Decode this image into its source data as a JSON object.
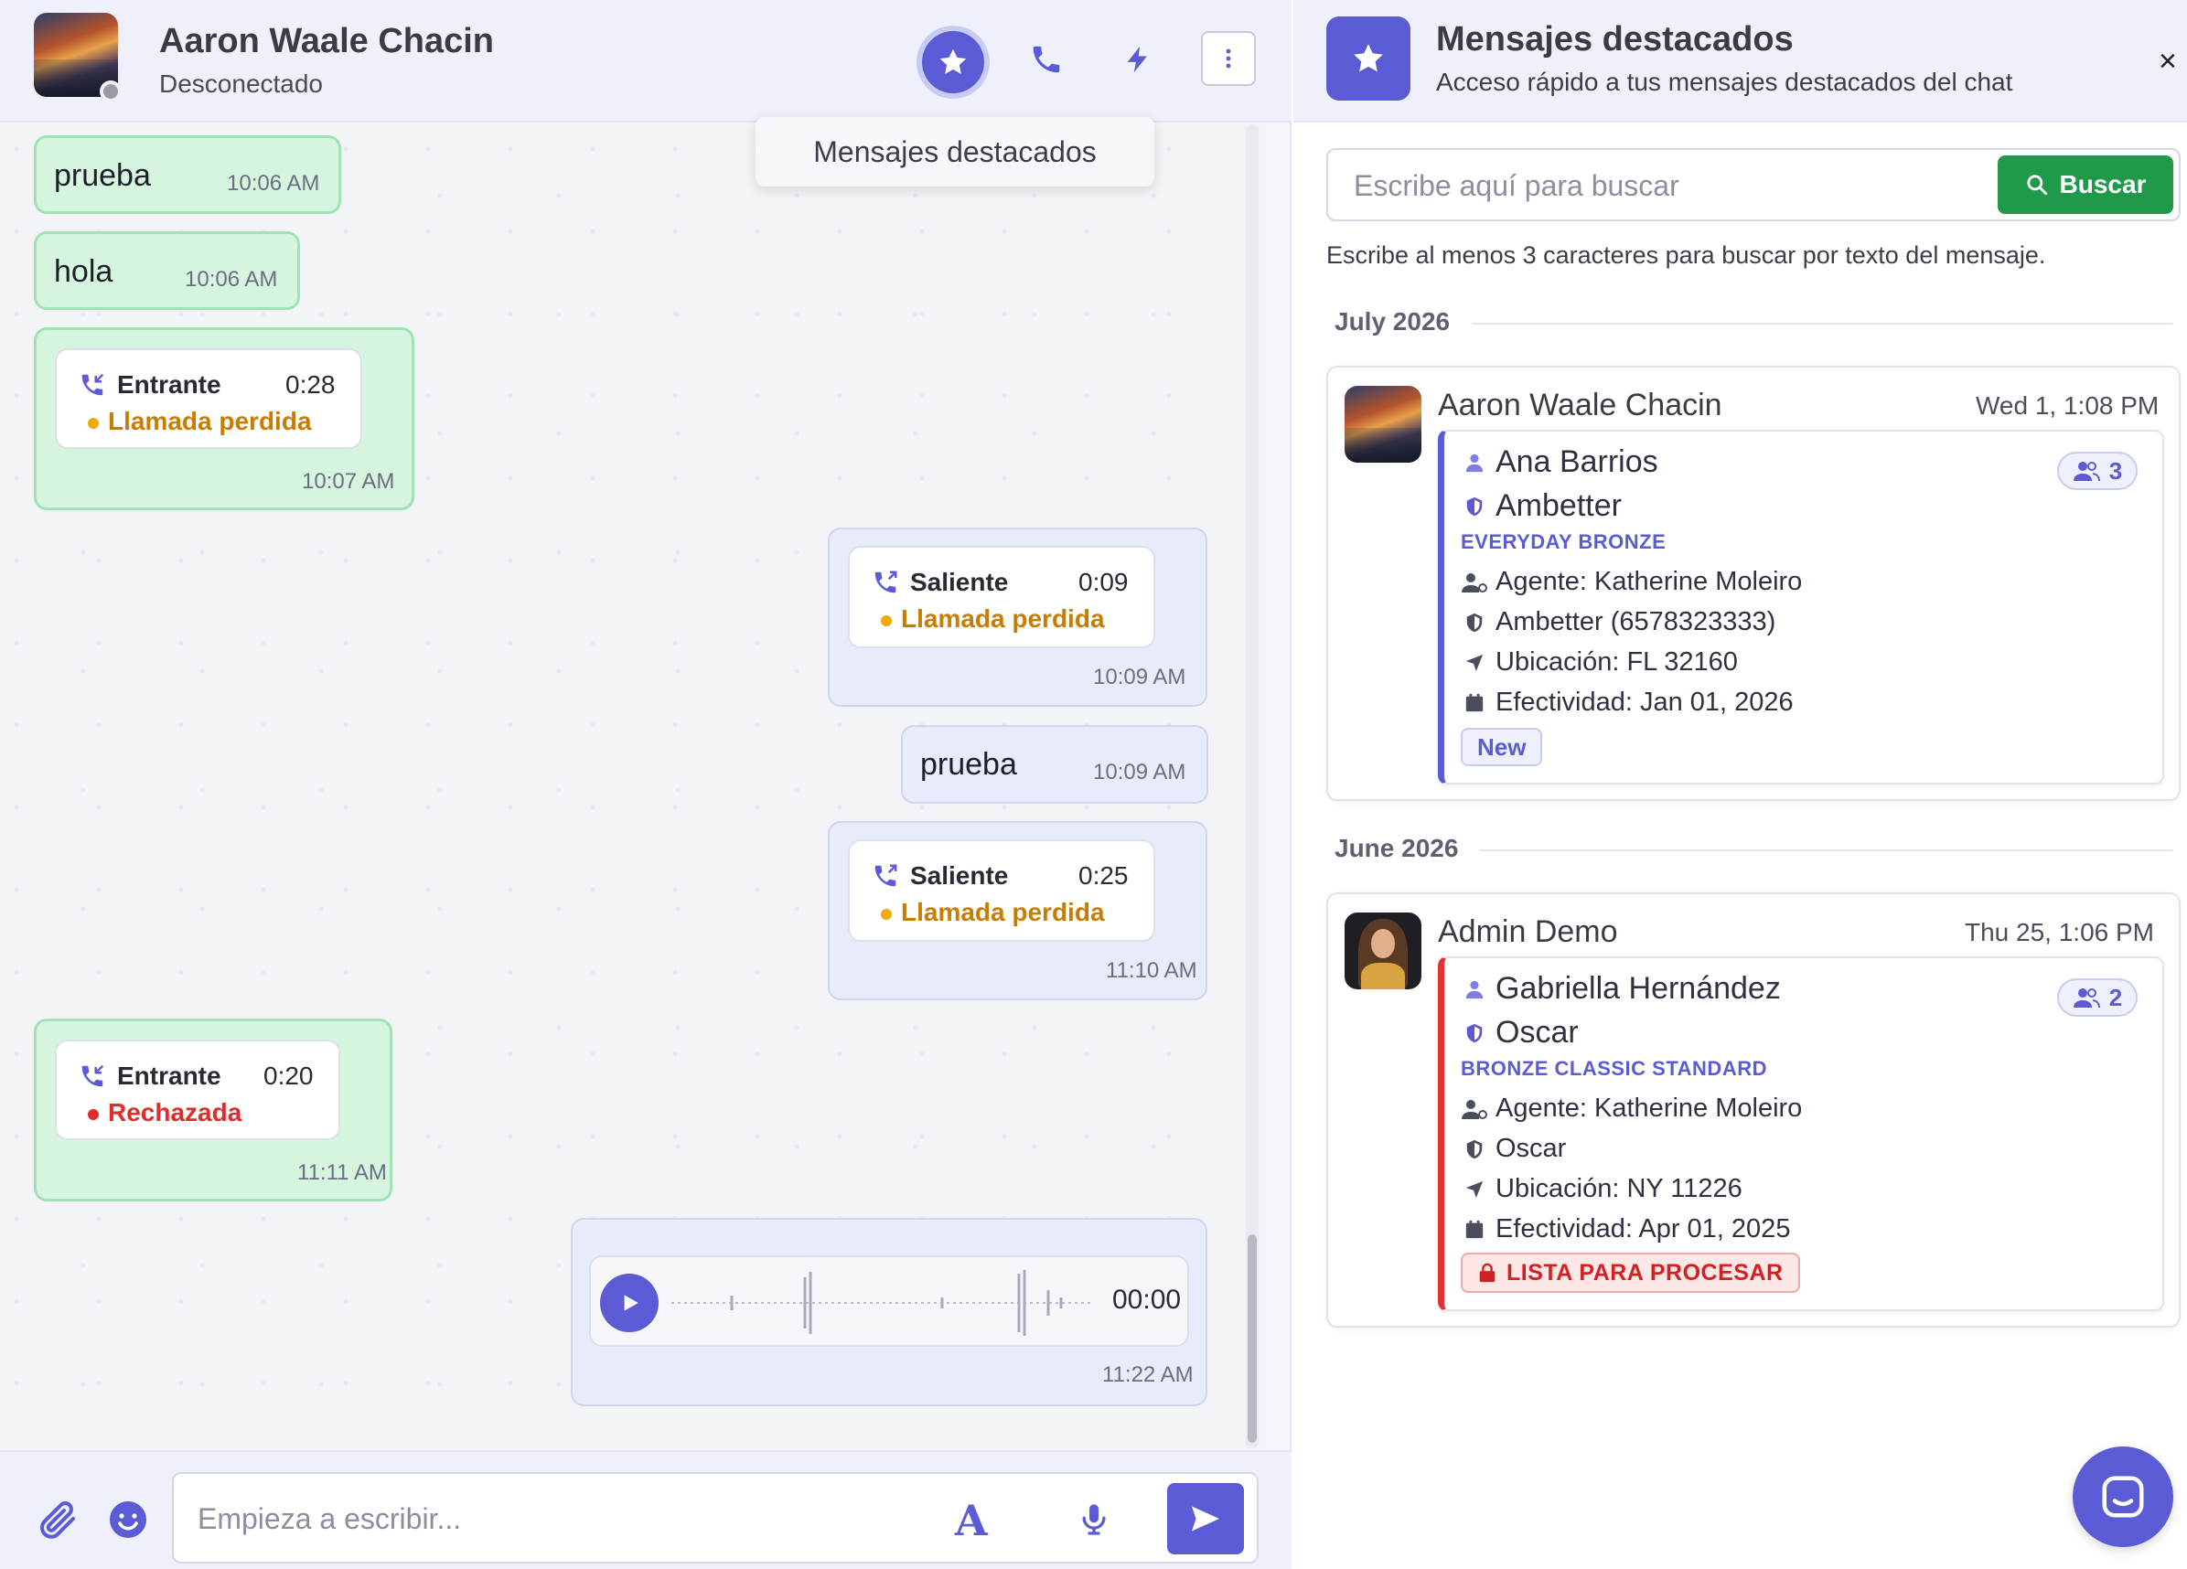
{
  "chat": {
    "contact_name": "Aaron Waale Chacin",
    "contact_status": "Desconectado",
    "tooltip": "Mensajes destacados",
    "composer_placeholder": "Empieza a escribir...",
    "font_icon_glyph": "A",
    "messages": [
      {
        "direction": "incoming",
        "type": "text",
        "text": "prueba",
        "time": "10:06 AM"
      },
      {
        "direction": "incoming",
        "type": "text",
        "text": "hola",
        "time": "10:06 AM"
      },
      {
        "direction": "incoming",
        "type": "call",
        "call_direction": "Entrante",
        "duration": "0:28",
        "status": "Llamada perdida",
        "time": "10:07 AM"
      },
      {
        "direction": "outgoing",
        "type": "call",
        "call_direction": "Saliente",
        "duration": "0:09",
        "status": "Llamada perdida",
        "time": "10:09 AM"
      },
      {
        "direction": "outgoing",
        "type": "text",
        "text": "prueba",
        "time": "10:09 AM"
      },
      {
        "direction": "outgoing",
        "type": "call",
        "call_direction": "Saliente",
        "duration": "0:25",
        "status": "Llamada perdida",
        "time": "11:10 AM"
      },
      {
        "direction": "incoming",
        "type": "call",
        "call_direction": "Entrante",
        "duration": "0:20",
        "status": "Rechazada",
        "time": "11:11 AM"
      },
      {
        "direction": "outgoing",
        "type": "audio",
        "audio_time": "00:00",
        "time": "11:22 AM"
      }
    ]
  },
  "panel": {
    "title": "Mensajes destacados",
    "subtitle": "Acceso rápido a tus mensajes destacados del chat",
    "close_label": "×",
    "search_placeholder": "Escribe aquí para buscar",
    "search_button": "Buscar",
    "search_hint": "Escribe al menos 3 caracteres para buscar por texto del mensaje.",
    "groups": [
      {
        "month": "July 2026",
        "card": {
          "name": "Aaron Waale Chacin",
          "date": "Wed 1, 1:08 PM",
          "person": "Ana Barrios",
          "carrier": "Ambetter",
          "plan": "EVERYDAY BRONZE",
          "count": "3",
          "agent": "Agente: Katherine Moleiro",
          "carrier_detail": "Ambetter (6578323333)",
          "location": "Ubicación: FL 32160",
          "effective": "Efectividad: Jan 01, 2026",
          "tag": "New"
        }
      },
      {
        "month": "June 2026",
        "card": {
          "name": "Admin Demo",
          "date": "Thu 25, 1:06 PM",
          "person": "Gabriella Hernández",
          "carrier": "Oscar",
          "plan": "BRONZE CLASSIC STANDARD",
          "count": "2",
          "agent": "Agente: Katherine Moleiro",
          "carrier_detail": "Oscar",
          "location": "Ubicación: NY 11226",
          "effective": "Efectividad: Apr 01, 2025",
          "tag": "LISTA PARA PROCESAR"
        }
      }
    ]
  },
  "colors": {
    "accent": "#5b5bd6",
    "incoming_bubble": "#d6f5df",
    "outgoing_bubble": "#e8ecfa",
    "missed": "#c77e00",
    "rejected": "#e22b2b",
    "search_button": "#1e9a4a"
  },
  "icons": {
    "header": [
      "star-icon",
      "phone-icon",
      "bolt-icon",
      "more-vertical-icon"
    ],
    "composer": [
      "paperclip-icon",
      "emoji-icon",
      "font-icon",
      "microphone-icon",
      "send-icon"
    ]
  }
}
